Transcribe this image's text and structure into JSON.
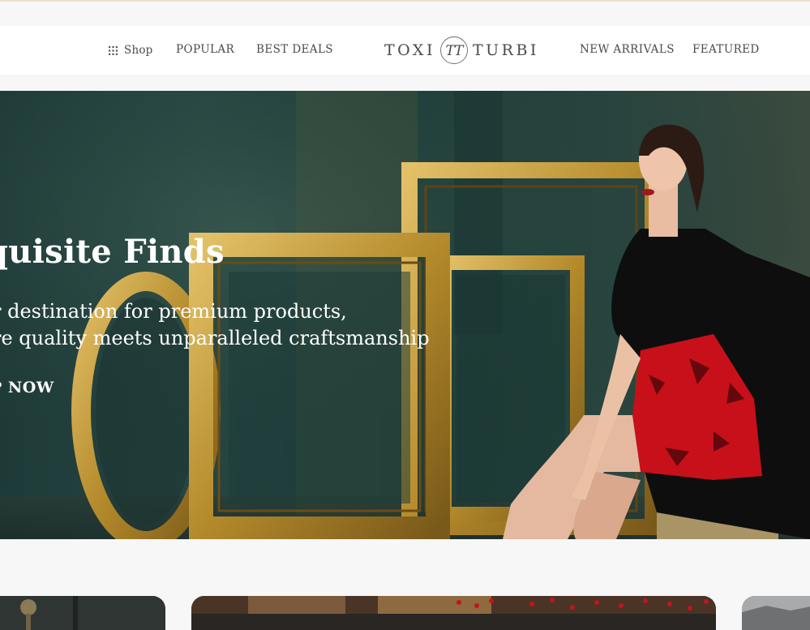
{
  "brand": {
    "left": "TOXI",
    "right": "TURBI",
    "monogram": "TT"
  },
  "nav": {
    "shop_label": "Shop",
    "shop_icon": "grid-icon",
    "left_items": [
      "POPULAR",
      "BEST DEALS"
    ],
    "right_items": [
      "NEW ARRIVALS",
      "FEATURED"
    ]
  },
  "hero": {
    "title": "quisite Finds",
    "subtitle_line1": "r destination for premium products,",
    "subtitle_line2": "re quality meets unparalleled craftsmanship",
    "cta": "P NOW"
  },
  "colors": {
    "background": "#f7f7f8",
    "nav_text": "#4a4a4a",
    "hero_text": "#ffffff",
    "gold": "#c9a13a",
    "teal_wall": "#1f3e3a",
    "dress_red": "#c8101a"
  }
}
